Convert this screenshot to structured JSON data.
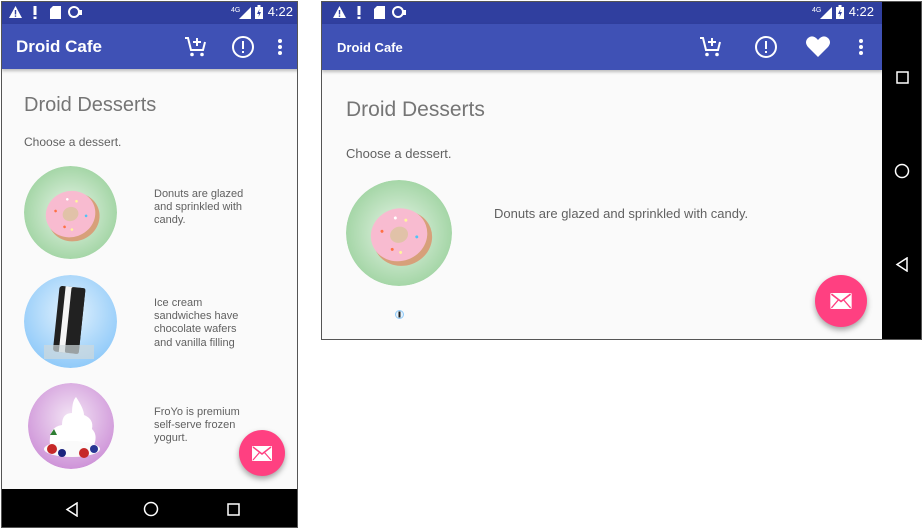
{
  "app": {
    "title": "Droid Cafe",
    "heading": "Droid Desserts",
    "subtitle": "Choose a dessert."
  },
  "status": {
    "time": "4:22",
    "network": "4G"
  },
  "desserts": [
    {
      "name": "donut",
      "description": "Donuts are glazed and sprinkled with candy."
    },
    {
      "name": "ice-cream-sandwich",
      "description": "Ice cream sandwiches have chocolate wafers and vanilla filling"
    },
    {
      "name": "froyo",
      "description": "FroYo is premium self-serve frozen yogurt."
    }
  ],
  "icons": {
    "cart": "shopping-cart-add-icon",
    "info": "exclamation-circle-icon",
    "favorite": "heart-icon",
    "overflow": "more-vert-icon",
    "fab": "email-icon",
    "nav_back": "back-triangle-icon",
    "nav_home": "home-circle-icon",
    "nav_recents": "recents-square-icon"
  },
  "colors": {
    "primary": "#3f51b5",
    "primary_dark": "#303f9f",
    "accent": "#ff4081",
    "text_secondary": "#757575"
  }
}
